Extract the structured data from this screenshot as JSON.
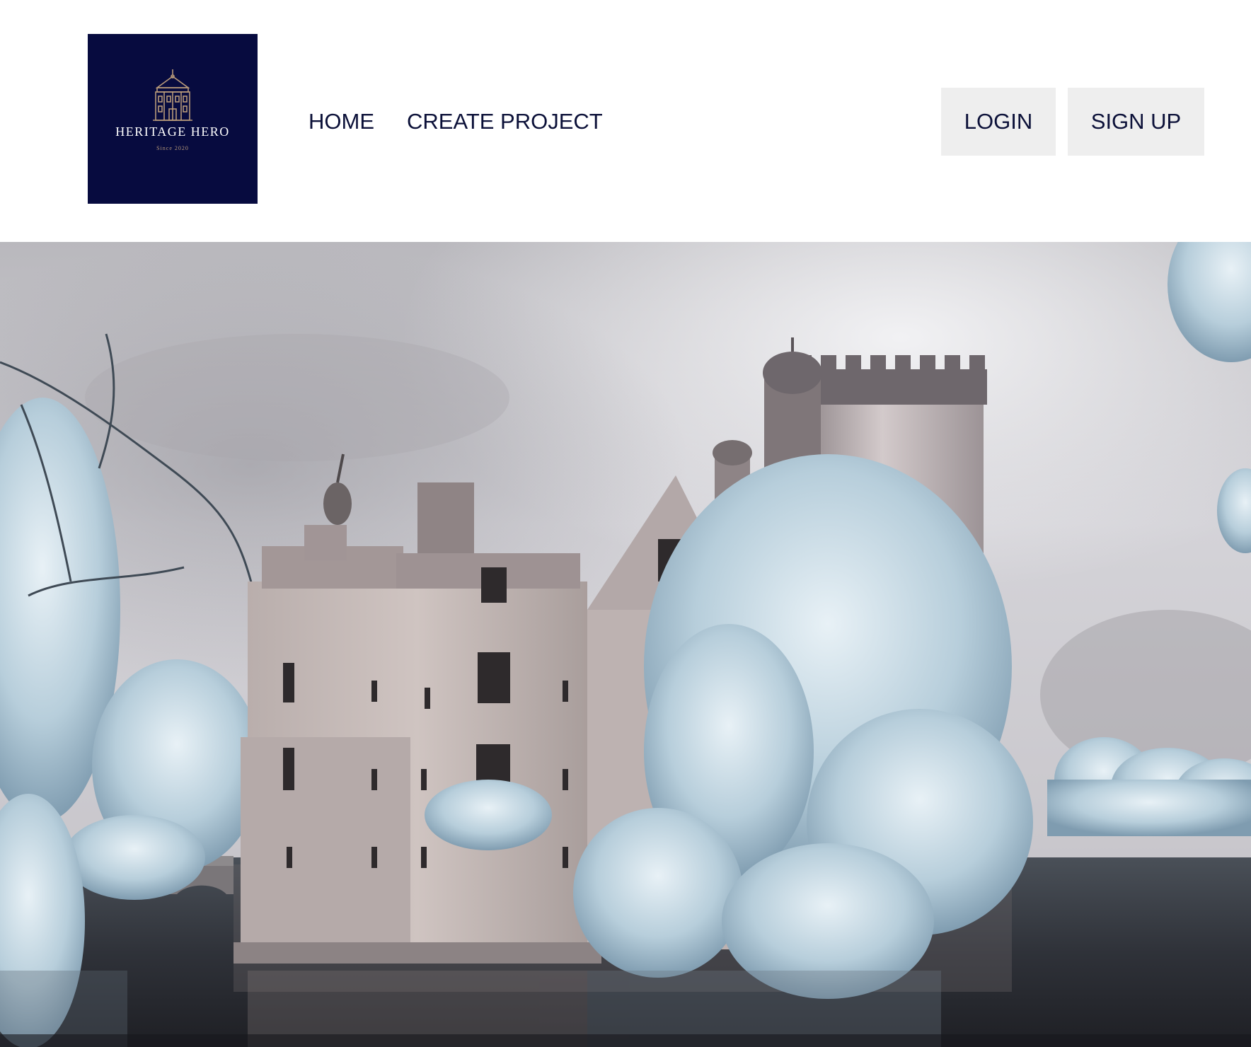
{
  "logo": {
    "title": "HERITAGE HERO",
    "subtitle": "Since 2020",
    "background": "#070b3f",
    "accent": "#b89a7a",
    "icon": "building-icon"
  },
  "nav": {
    "items": [
      {
        "label": "HOME"
      },
      {
        "label": "CREATE PROJECT"
      }
    ]
  },
  "auth": {
    "login_label": "LOGIN",
    "signup_label": "SIGN UP",
    "button_background": "#eeeeee",
    "text_color": "#0b1038"
  },
  "hero": {
    "image_subject": "castle-by-lake-photo"
  }
}
